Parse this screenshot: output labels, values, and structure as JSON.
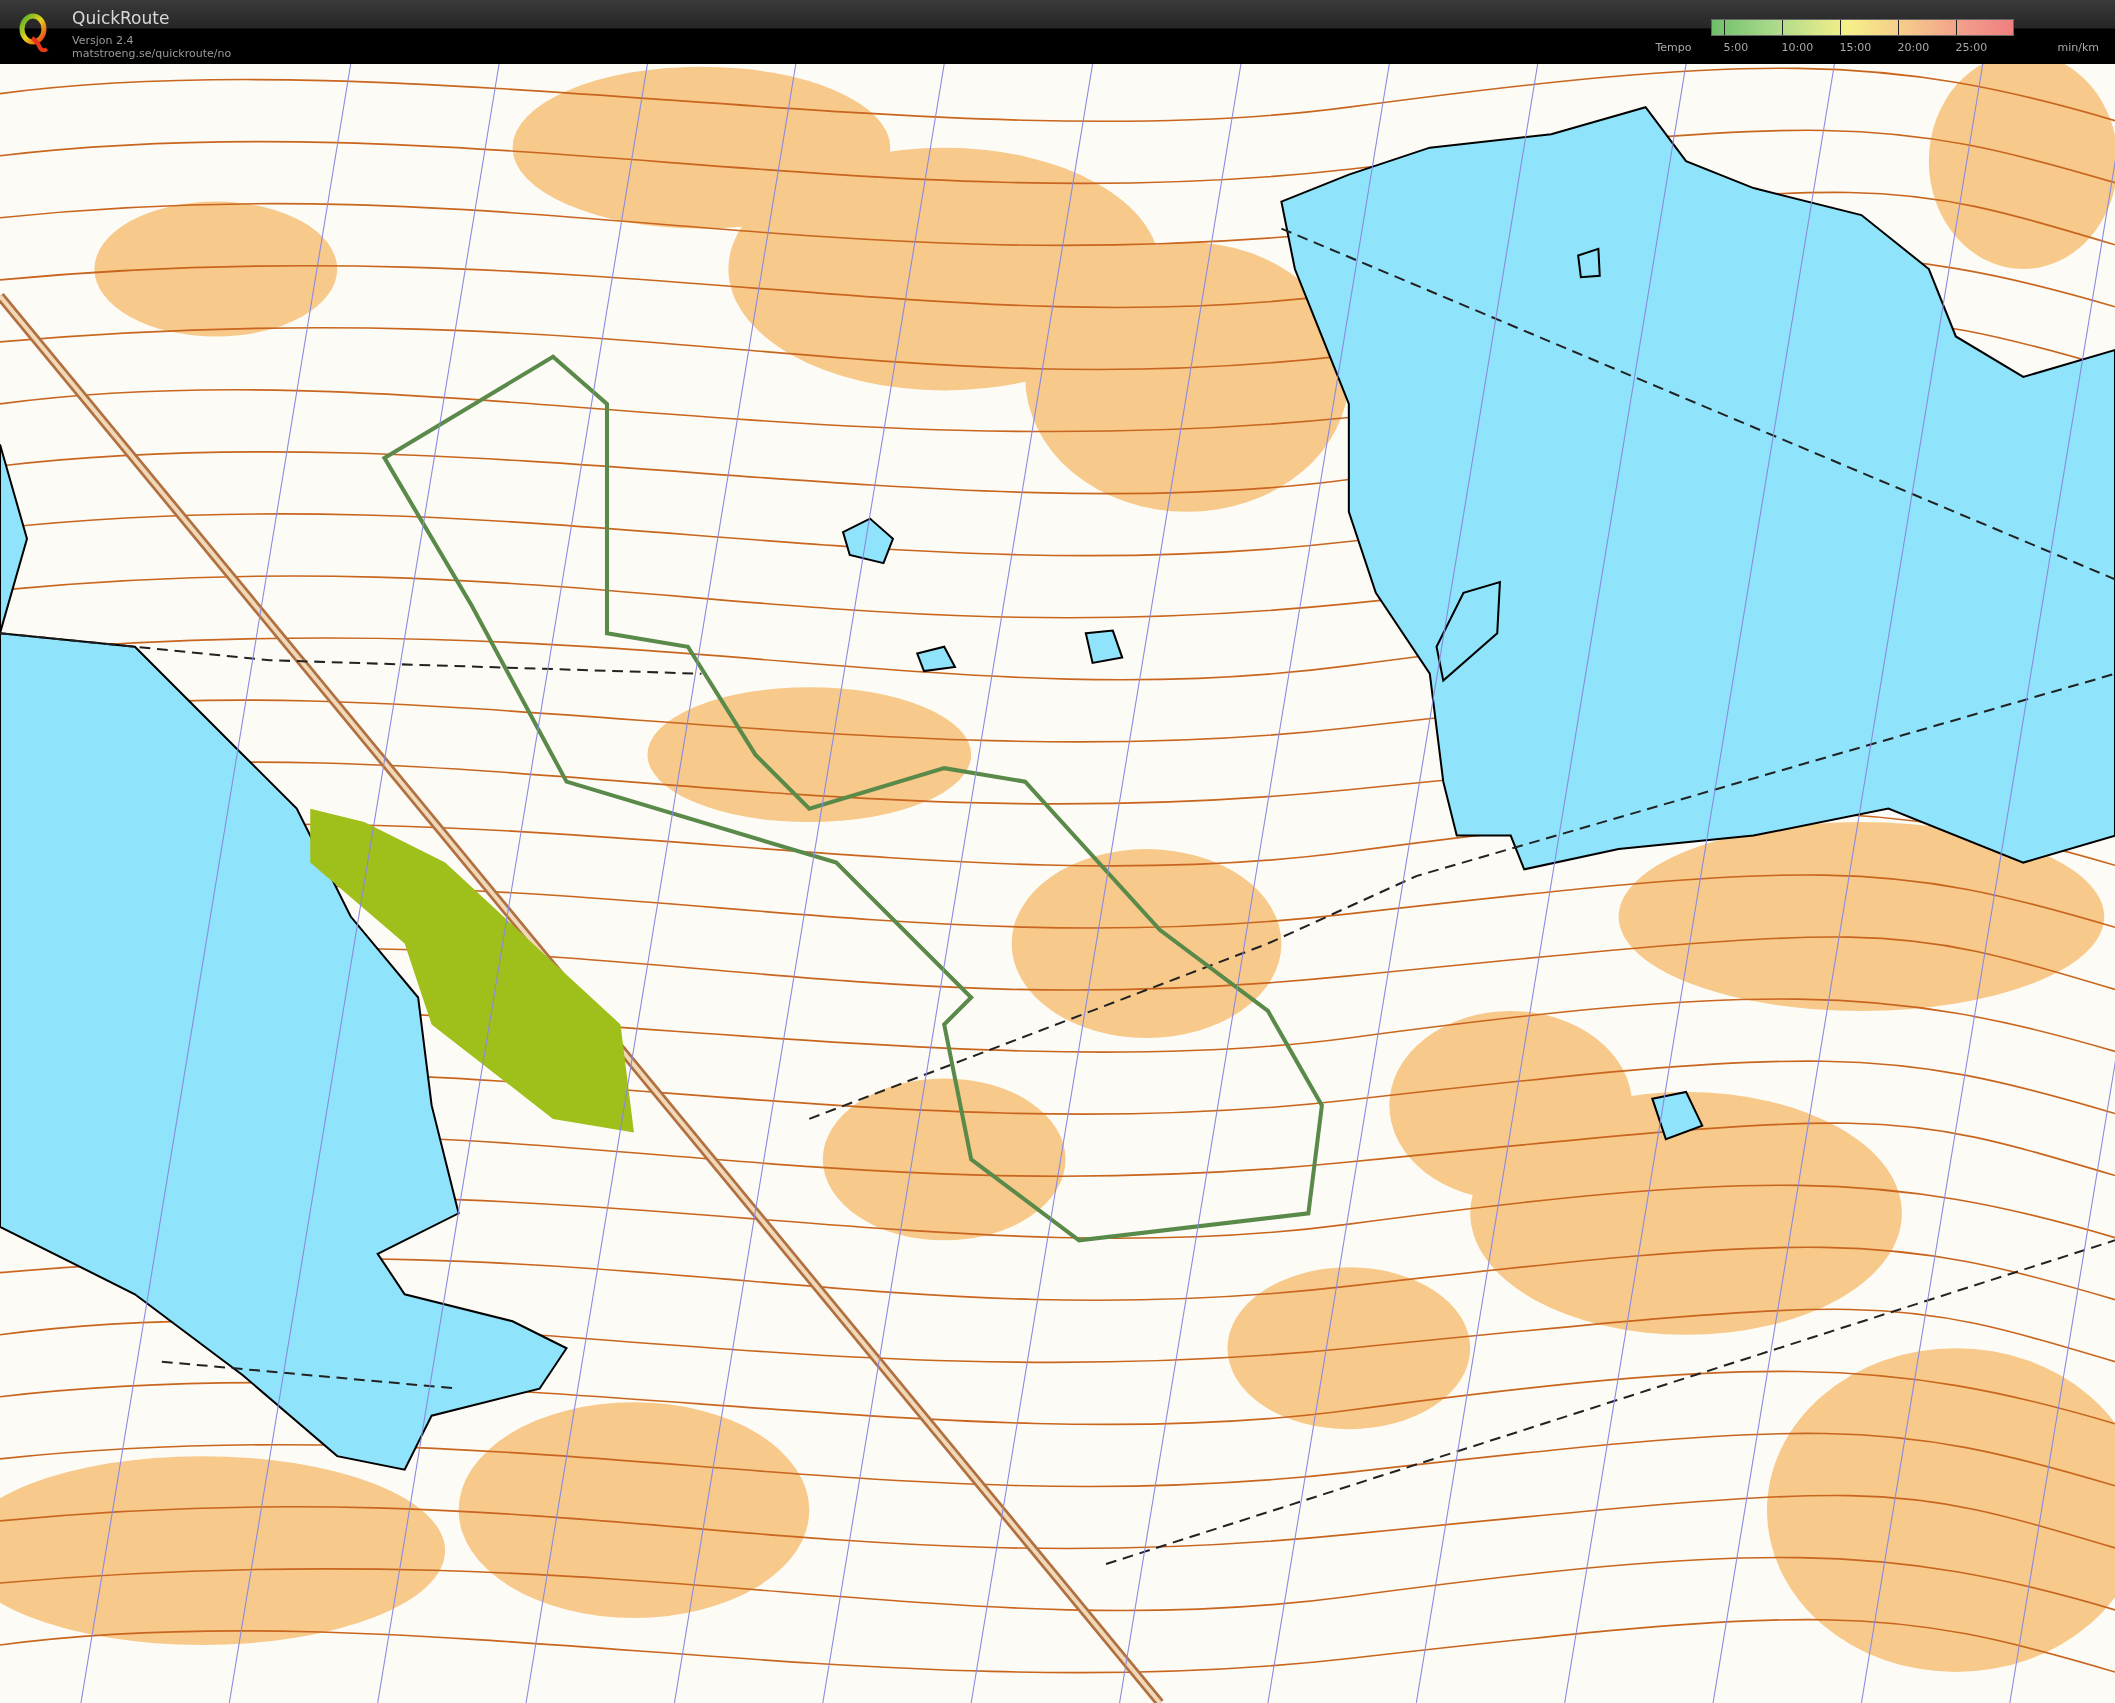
{
  "header": {
    "title": "QuickRoute",
    "version": "Versjon 2.4",
    "url": "matstroeng.se/quickroute/no"
  },
  "legend": {
    "label": "Tempo",
    "ticks": [
      "5:00",
      "10:00",
      "15:00",
      "20:00",
      "25:00"
    ],
    "unit": "min/km"
  }
}
